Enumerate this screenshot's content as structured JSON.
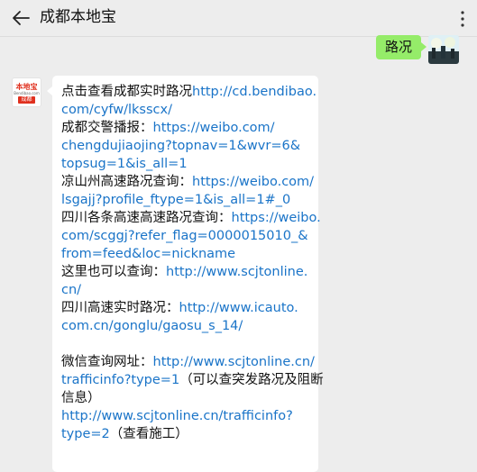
{
  "header": {
    "title": "成都本地宝",
    "back_icon": "back-arrow-icon",
    "more_icon": "more-vertical-icon"
  },
  "outgoing": {
    "text": "路况"
  },
  "bot": {
    "logo_top": "本地宝",
    "logo_mid": "Bendibao.com",
    "logo_city": "成都"
  },
  "message": {
    "lines": [
      {
        "pre": "点击查看成都实时路况",
        "link": "http://cd.bendibao."
      },
      {
        "pre": "",
        "link": "com/cyfw/lksscx/"
      },
      {
        "pre": "成都交警播报：",
        "link": "https://weibo.com/"
      },
      {
        "pre": "",
        "link": "chengdujiaojing?topnav=1&wvr=6&"
      },
      {
        "pre": "",
        "link": "topsug=1&is_all=1"
      },
      {
        "pre": "凉山州高速路况查询：",
        "link": "https://weibo.com/"
      },
      {
        "pre": "",
        "link": "lsgajj?profile_ftype=1&is_all=1#_0"
      },
      {
        "pre": "四川各条高速高速路况查询：",
        "link": "https://weibo."
      },
      {
        "pre": "",
        "link": "com/scggj?refer_flag=0000015010_&"
      },
      {
        "pre": "",
        "link": "from=feed&loc=nickname"
      },
      {
        "pre": "这里也可以查询：",
        "link": "http://www.scjtonline."
      },
      {
        "pre": "",
        "link": "cn/"
      },
      {
        "pre": "四川高速实时路况：",
        "link": "http://www.icauto."
      },
      {
        "pre": "",
        "link": "com.cn/gonglu/gaosu_s_14/"
      },
      {
        "pre": "",
        "link": ""
      },
      {
        "pre": "微信查询网址：",
        "link": "http://www.scjtonline.cn/"
      },
      {
        "pre": "",
        "link": "trafficinfo?type=1",
        "post": "（可以查突发路况及阻断"
      },
      {
        "pre": "信息）",
        "link": ""
      },
      {
        "pre": "",
        "link": "http://www.scjtonline.cn/trafficinfo?"
      },
      {
        "pre": "",
        "link": "type=2",
        "post": "（查看施工）"
      }
    ]
  }
}
